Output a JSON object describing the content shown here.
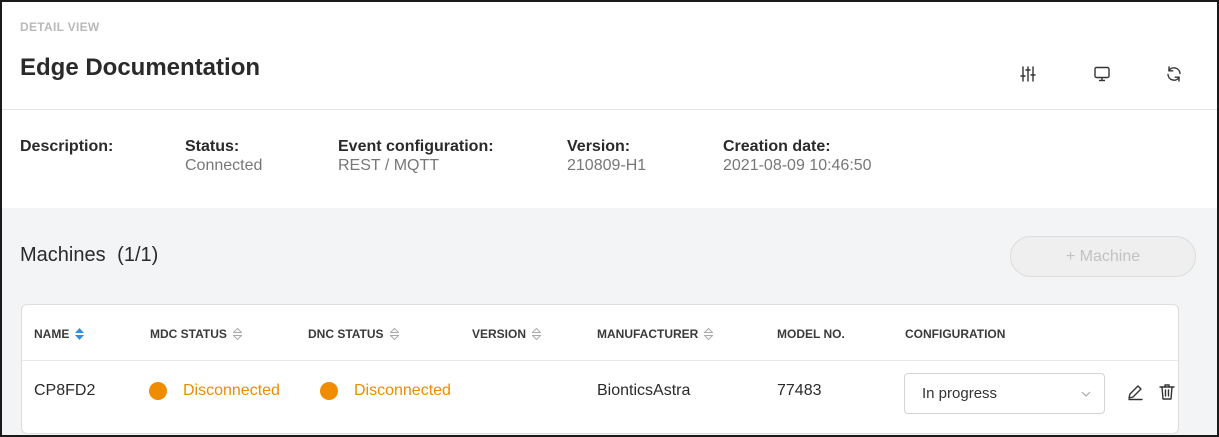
{
  "header": {
    "eyebrow": "DETAIL VIEW",
    "title": "Edge Documentation",
    "tools": [
      "sliders-icon",
      "monitor-icon",
      "refresh-icon"
    ]
  },
  "info": {
    "description_label": "Description:",
    "status_label": "Status:",
    "status_value": "Connected",
    "event_label": "Event configuration:",
    "event_value": "REST / MQTT",
    "version_label": "Version:",
    "version_value": "210809-H1",
    "created_label": "Creation date:",
    "created_value": "2021-08-09 10:46:50"
  },
  "machines": {
    "title": "Machines",
    "count": "(1/1)",
    "add_label": "+ Machine",
    "columns": [
      "NAME",
      "MDC STATUS",
      "DNC STATUS",
      "VERSION",
      "MANUFACTURER",
      "MODEL NO.",
      "CONFIGURATION"
    ],
    "rows": [
      {
        "name": "CP8FD2",
        "mdc_status": "Disconnected",
        "dnc_status": "Disconnected",
        "version": "",
        "manufacturer": "BionticsAstra",
        "model": "77483",
        "configuration": "In progress"
      }
    ]
  },
  "colors": {
    "accent": "#2f8fe6",
    "warning": "#f08c00",
    "panel_bg": "#f3f4f5"
  }
}
